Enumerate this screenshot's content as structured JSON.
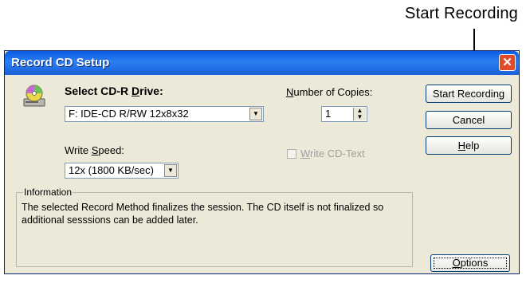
{
  "callout": {
    "text": "Start Recording"
  },
  "window": {
    "title": "Record CD Setup",
    "close_symbol": "✕"
  },
  "drive": {
    "label_pre": "Select CD-R ",
    "label_accel": "D",
    "label_post": "rive:",
    "selected": "F: IDE-CD R/RW 12x8x32"
  },
  "copies": {
    "label_accel": "N",
    "label_post": "umber of Copies:",
    "value": "1"
  },
  "speed": {
    "label_pre": "Write ",
    "label_accel": "S",
    "label_post": "peed:",
    "selected": "12x (1800 KB/sec)"
  },
  "cdtext": {
    "label_accel": "W",
    "label_post": "rite CD-Text",
    "checked": false
  },
  "buttons": {
    "start": "Start Recording",
    "cancel": "Cancel",
    "help_accel": "H",
    "help_post": "elp",
    "options_accel": "O",
    "options_post": "ptions"
  },
  "information": {
    "legend": "Information",
    "text": "The selected Record Method finalizes the session. The CD itself is not finalized so additional sesssions can be added later."
  },
  "icons": [
    "cd-drive-icon",
    "close-icon",
    "chevron-down-icon",
    "spin-up-icon",
    "spin-down-icon"
  ]
}
